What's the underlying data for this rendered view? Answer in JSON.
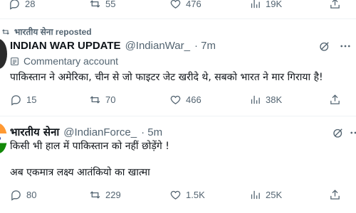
{
  "top_row": {
    "replies": "28",
    "reposts": "55",
    "likes": "476",
    "views": "19K"
  },
  "tweet1": {
    "repost_label": "भारतीय सेना reposted",
    "display_name": "INDIAN WAR UPDATE",
    "handle": "@IndianWar_",
    "time": "· 7m",
    "commentary_label": "Commentary account",
    "text": "पाकिस्तान ने अमेरिका, चीन से जो फाइटर जेट खरीदे थे, सबको भारत ने मार गिराया है!",
    "replies": "15",
    "reposts": "70",
    "likes": "466",
    "views": "38K"
  },
  "tweet2": {
    "display_name": "भारतीय सेना",
    "handle": "@IndianForce_",
    "time": "· 5m",
    "text_line1": "किसी भी हाल में पाकिस्तान को नहीं छोड़ेंगे !",
    "text_line2": "अब एकमात्र लक्ष्य आतंकियो का खात्मा",
    "replies": "80",
    "reposts": "229",
    "likes": "1.5K",
    "views": "25K"
  },
  "icons": {
    "reply": "reply-icon",
    "repost": "repost-icon",
    "like": "heart-icon",
    "views": "views-icon",
    "share": "share-icon",
    "grok": "grok-icon",
    "more": "more-icon"
  },
  "colors": {
    "text": "#0f1419",
    "muted": "#536471",
    "divider": "#eff3f4"
  }
}
